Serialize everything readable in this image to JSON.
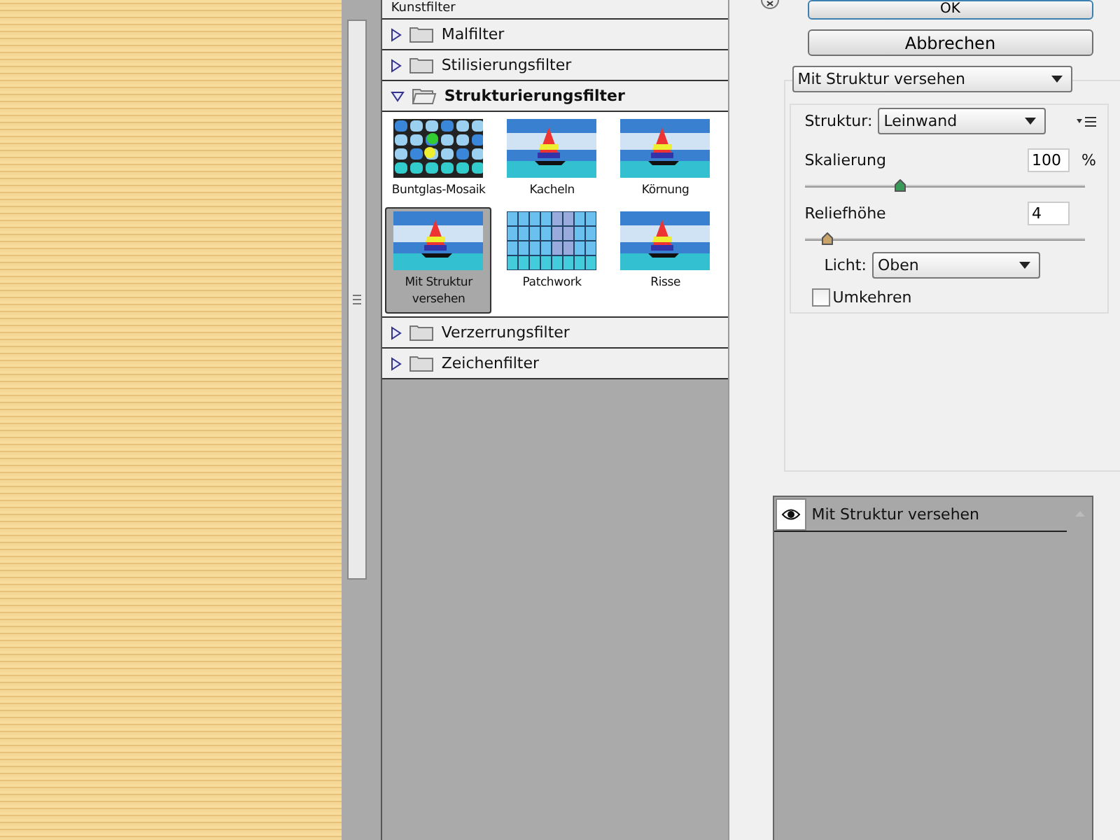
{
  "filter_list": {
    "categories": [
      {
        "label": "Kunstfilter",
        "expanded": false
      },
      {
        "label": "Malfilter",
        "expanded": false
      },
      {
        "label": "Stilisierungsfilter",
        "expanded": false
      },
      {
        "label": "Strukturierungsfilter",
        "expanded": true,
        "filters": [
          {
            "label": "Buntglas-Mosaik",
            "selected": false,
            "kind": "mosaic"
          },
          {
            "label": "Kacheln",
            "selected": false,
            "kind": "boat"
          },
          {
            "label": "Körnung",
            "selected": false,
            "kind": "boat"
          },
          {
            "label": "Mit Struktur versehen",
            "selected": true,
            "kind": "boat"
          },
          {
            "label": "Patchwork",
            "selected": false,
            "kind": "patch"
          },
          {
            "label": "Risse",
            "selected": false,
            "kind": "boat"
          }
        ]
      },
      {
        "label": "Verzerrungsfilter",
        "expanded": false
      },
      {
        "label": "Zeichenfilter",
        "expanded": false
      }
    ]
  },
  "buttons": [
    "OK",
    "Abbrechen"
  ],
  "filter_dropdown": "Mit Struktur versehen",
  "settings": {
    "structure_label": "Struktur:",
    "structure_value": "Leinwand",
    "scaling": {
      "label": "Skalierung",
      "value": "100",
      "unit": "%",
      "level": 0.34
    },
    "relief": {
      "label": "Reliefhöhe",
      "value": "4",
      "level": 0.08
    },
    "light_label": "Licht:",
    "light_value": "Oben",
    "invert": {
      "label": "Umkehren",
      "checked": false
    }
  },
  "effect_layers": [
    {
      "label": "Mit Struktur versehen",
      "visible": true
    }
  ]
}
